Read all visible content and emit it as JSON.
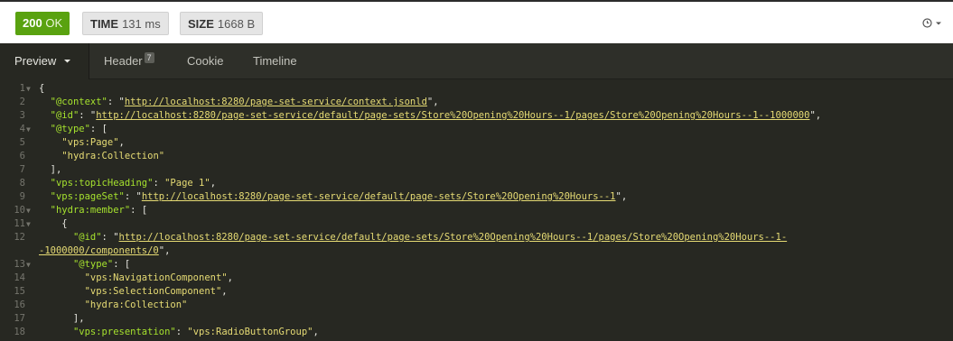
{
  "status": {
    "code": "200",
    "text": "OK",
    "color": "#59a210"
  },
  "time": {
    "label": "TIME",
    "value": "131 ms"
  },
  "size": {
    "label": "SIZE",
    "value": "1668 B"
  },
  "history_icon": "clock-icon",
  "tabs": [
    {
      "label": "Preview",
      "active": true
    },
    {
      "label": "Header",
      "count": "7"
    },
    {
      "label": "Cookie"
    },
    {
      "label": "Timeline"
    }
  ],
  "code_lines": [
    {
      "n": "1",
      "fold": true,
      "segs": [
        [
          "p",
          "{"
        ]
      ]
    },
    {
      "n": "2",
      "segs": [
        [
          "p",
          "  "
        ],
        [
          "k",
          "\"@context\""
        ],
        [
          "p",
          ": \""
        ],
        [
          "u",
          "http://localhost:8280/page-set-service/context.jsonld"
        ],
        [
          "p",
          "\","
        ]
      ]
    },
    {
      "n": "3",
      "segs": [
        [
          "p",
          "  "
        ],
        [
          "k",
          "\"@id\""
        ],
        [
          "p",
          ": \""
        ],
        [
          "u",
          "http://localhost:8280/page-set-service/default/page-sets/Store%20Opening%20Hours--1/pages/Store%20Opening%20Hours--1--1000000"
        ],
        [
          "p",
          "\","
        ]
      ]
    },
    {
      "n": "4",
      "fold": true,
      "segs": [
        [
          "p",
          "  "
        ],
        [
          "k",
          "\"@type\""
        ],
        [
          "p",
          ": ["
        ]
      ]
    },
    {
      "n": "5",
      "segs": [
        [
          "p",
          "    "
        ],
        [
          "s",
          "\"vps:Page\""
        ],
        [
          "p",
          ","
        ]
      ]
    },
    {
      "n": "6",
      "segs": [
        [
          "p",
          "    "
        ],
        [
          "s",
          "\"hydra:Collection\""
        ]
      ]
    },
    {
      "n": "7",
      "segs": [
        [
          "p",
          "  ],"
        ]
      ]
    },
    {
      "n": "8",
      "segs": [
        [
          "p",
          "  "
        ],
        [
          "k",
          "\"vps:topicHeading\""
        ],
        [
          "p",
          ": "
        ],
        [
          "s",
          "\"Page 1\""
        ],
        [
          "p",
          ","
        ]
      ]
    },
    {
      "n": "9",
      "segs": [
        [
          "p",
          "  "
        ],
        [
          "k",
          "\"vps:pageSet\""
        ],
        [
          "p",
          ": \""
        ],
        [
          "u",
          "http://localhost:8280/page-set-service/default/page-sets/Store%20Opening%20Hours--1"
        ],
        [
          "p",
          "\","
        ]
      ]
    },
    {
      "n": "10",
      "fold": true,
      "segs": [
        [
          "p",
          "  "
        ],
        [
          "k",
          "\"hydra:member\""
        ],
        [
          "p",
          ": ["
        ]
      ]
    },
    {
      "n": "11",
      "fold": true,
      "segs": [
        [
          "p",
          "    {"
        ]
      ]
    },
    {
      "n": "12",
      "segs": [
        [
          "p",
          "      "
        ],
        [
          "k",
          "\"@id\""
        ],
        [
          "p",
          ": \""
        ],
        [
          "u",
          "http://localhost:8280/page-set-service/default/page-sets/Store%20Opening%20Hours--1/pages/Store%20Opening%20Hours--1-"
        ]
      ]
    },
    {
      "n": "",
      "segs": [
        [
          "u",
          "-1000000/components/0"
        ],
        [
          "p",
          "\","
        ]
      ]
    },
    {
      "n": "13",
      "fold": true,
      "segs": [
        [
          "p",
          "      "
        ],
        [
          "k",
          "\"@type\""
        ],
        [
          "p",
          ": ["
        ]
      ]
    },
    {
      "n": "14",
      "segs": [
        [
          "p",
          "        "
        ],
        [
          "s",
          "\"vps:NavigationComponent\""
        ],
        [
          "p",
          ","
        ]
      ]
    },
    {
      "n": "15",
      "segs": [
        [
          "p",
          "        "
        ],
        [
          "s",
          "\"vps:SelectionComponent\""
        ],
        [
          "p",
          ","
        ]
      ]
    },
    {
      "n": "16",
      "segs": [
        [
          "p",
          "        "
        ],
        [
          "s",
          "\"hydra:Collection\""
        ]
      ]
    },
    {
      "n": "17",
      "segs": [
        [
          "p",
          "      ],"
        ]
      ]
    },
    {
      "n": "18",
      "segs": [
        [
          "p",
          "      "
        ],
        [
          "k",
          "\"vps:presentation\""
        ],
        [
          "p",
          ": "
        ],
        [
          "s",
          "\"vps:RadioButtonGroup\""
        ],
        [
          "p",
          ","
        ]
      ]
    }
  ]
}
